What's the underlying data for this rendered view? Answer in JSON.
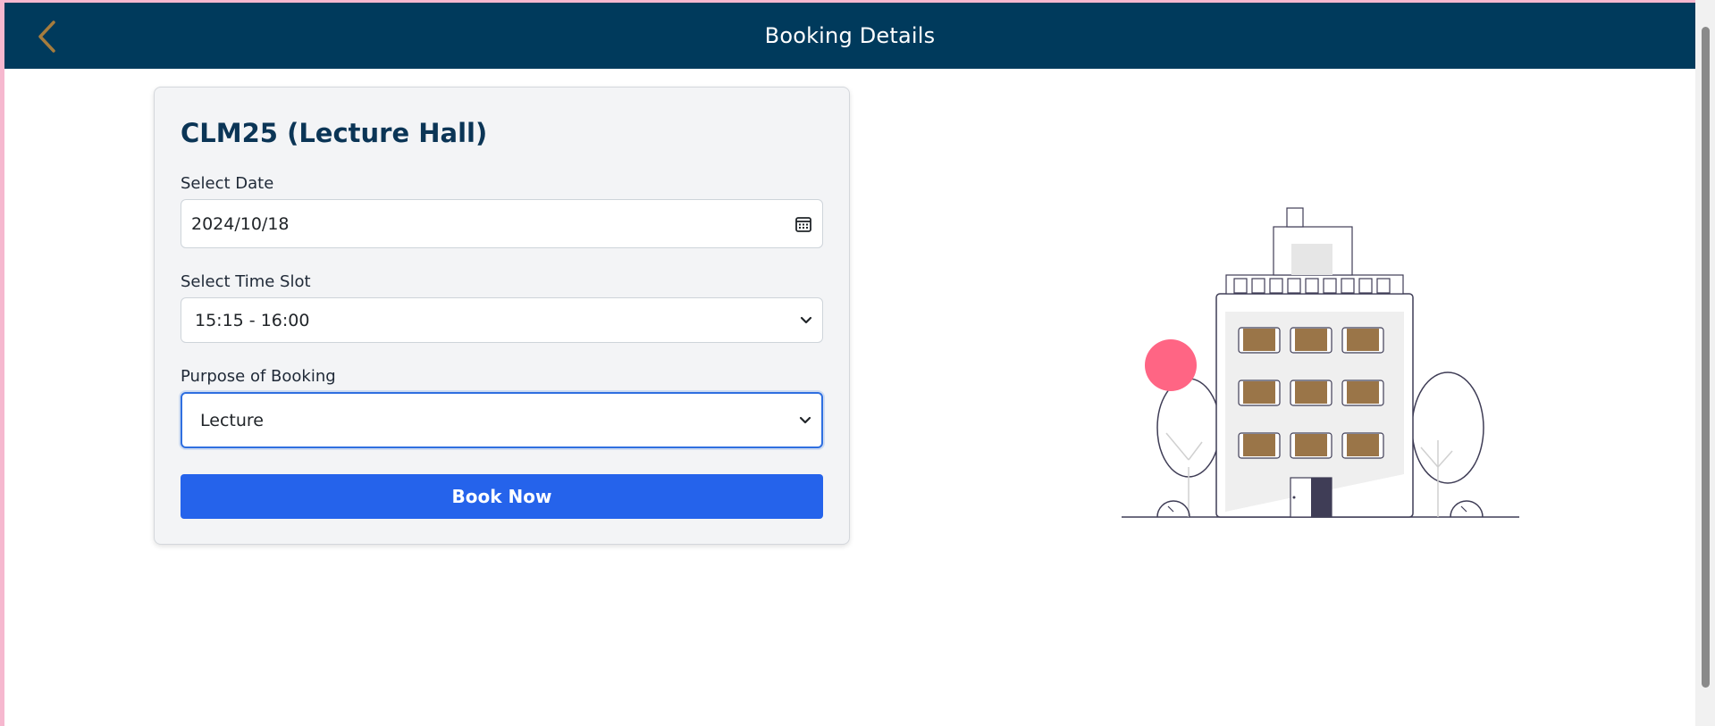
{
  "header": {
    "title": "Booking Details",
    "back_icon": "chevron-left-icon",
    "background": "#003a5c",
    "back_color": "#a67c3d"
  },
  "card": {
    "title": "CLM25 (Lecture Hall)",
    "date": {
      "label": "Select Date",
      "value": "2024/10/18",
      "icon": "calendar-icon"
    },
    "time_slot": {
      "label": "Select Time Slot",
      "value": "15:15 - 16:00",
      "icon": "chevron-down-icon"
    },
    "purpose": {
      "label": "Purpose of Booking",
      "value": "Lecture",
      "icon": "chevron-down-icon"
    },
    "submit_label": "Book Now",
    "submit_color": "#2563eb"
  },
  "illustration": {
    "icon": "building-illustration",
    "accent": "#ff6584",
    "window_color": "#9a7548"
  }
}
